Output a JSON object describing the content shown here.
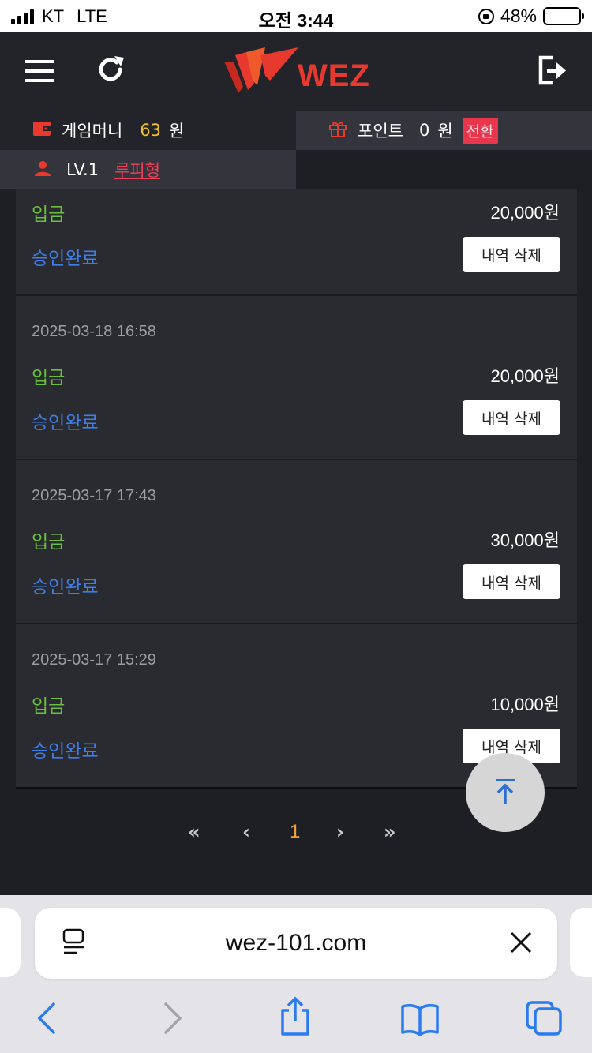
{
  "status_bar": {
    "carrier": "KT",
    "network": "LTE",
    "time": "오전 3:44",
    "battery_percent": "48%",
    "battery_level": 0.48
  },
  "header": {
    "logo_text": "WEZ",
    "icons": [
      "menu-icon",
      "refresh-icon",
      "logout-icon"
    ]
  },
  "account": {
    "money_label": "게임머니",
    "money_value": "63",
    "money_unit": "원",
    "point_label": "포인트",
    "point_value": "0",
    "point_unit": "원",
    "convert_label": "전환",
    "level": "LV.1",
    "nickname": "루피형"
  },
  "transactions": [
    {
      "date": "",
      "type": "입금",
      "amount": "20,000원",
      "status": "승인완료",
      "delete_label": "내역 삭제"
    },
    {
      "date": "2025-03-18 16:58",
      "type": "입금",
      "amount": "20,000원",
      "status": "승인완료",
      "delete_label": "내역 삭제"
    },
    {
      "date": "2025-03-17 17:43",
      "type": "입금",
      "amount": "30,000원",
      "status": "승인완료",
      "delete_label": "내역 삭제"
    },
    {
      "date": "2025-03-17 15:29",
      "type": "입금",
      "amount": "10,000원",
      "status": "승인완료",
      "delete_label": "내역 삭제"
    }
  ],
  "pagination": {
    "first": "«",
    "prev": "‹",
    "current": "1",
    "next": "›",
    "last": "»"
  },
  "browser": {
    "url": "wez-101.com"
  },
  "colors": {
    "background": "#1e1f24",
    "accent_red": "#e8392f",
    "money_yellow": "#f2c12e",
    "type_green": "#6bbf3f",
    "status_blue": "#3e7ee8",
    "page_current": "#f2a23a"
  }
}
